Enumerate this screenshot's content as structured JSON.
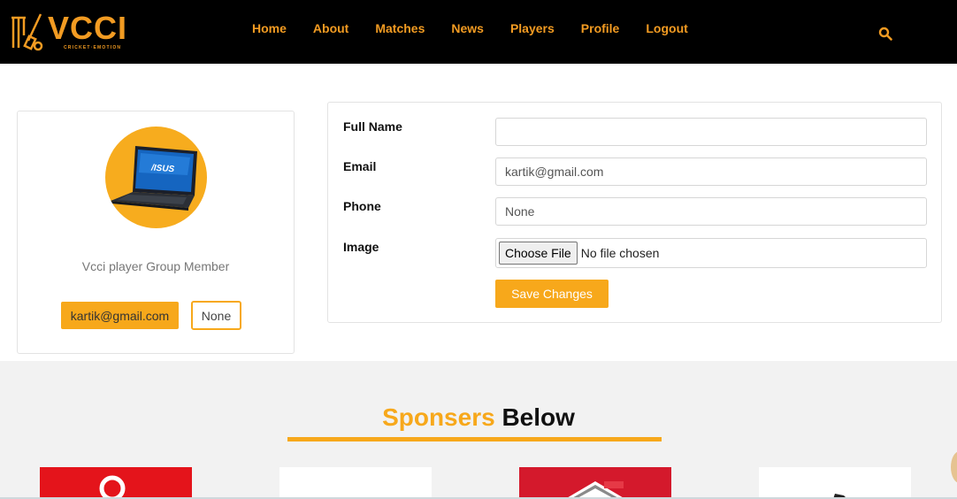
{
  "brand": {
    "name": "VCCI",
    "tagline": "CRICKET·EMOTION",
    "logo_icon": "cricket-bat-wickets-icon"
  },
  "nav": {
    "items": [
      "Home",
      "About",
      "Matches",
      "News",
      "Players",
      "Profile",
      "Logout"
    ],
    "search_icon": "search-icon"
  },
  "profile": {
    "avatar_icon": "laptop-image",
    "avatar_brand": "/ISUS",
    "group": "Vcci player Group Member",
    "email_badge": "kartik@gmail.com",
    "phone_badge": "None"
  },
  "form": {
    "full_name_label": "Full Name",
    "full_name_value": "",
    "email_label": "Email",
    "email_value": "kartik@gmail.com",
    "phone_label": "Phone",
    "phone_value": "None",
    "image_label": "Image",
    "file_button": "Choose File",
    "file_status": "No file chosen",
    "save_button": "Save Changes"
  },
  "sponsors": {
    "title_highlight": "Sponsers",
    "title_rest": "Below"
  },
  "colors": {
    "accent": "#f7a81b",
    "navbar": "#000000",
    "nav_text": "#f29b22"
  }
}
